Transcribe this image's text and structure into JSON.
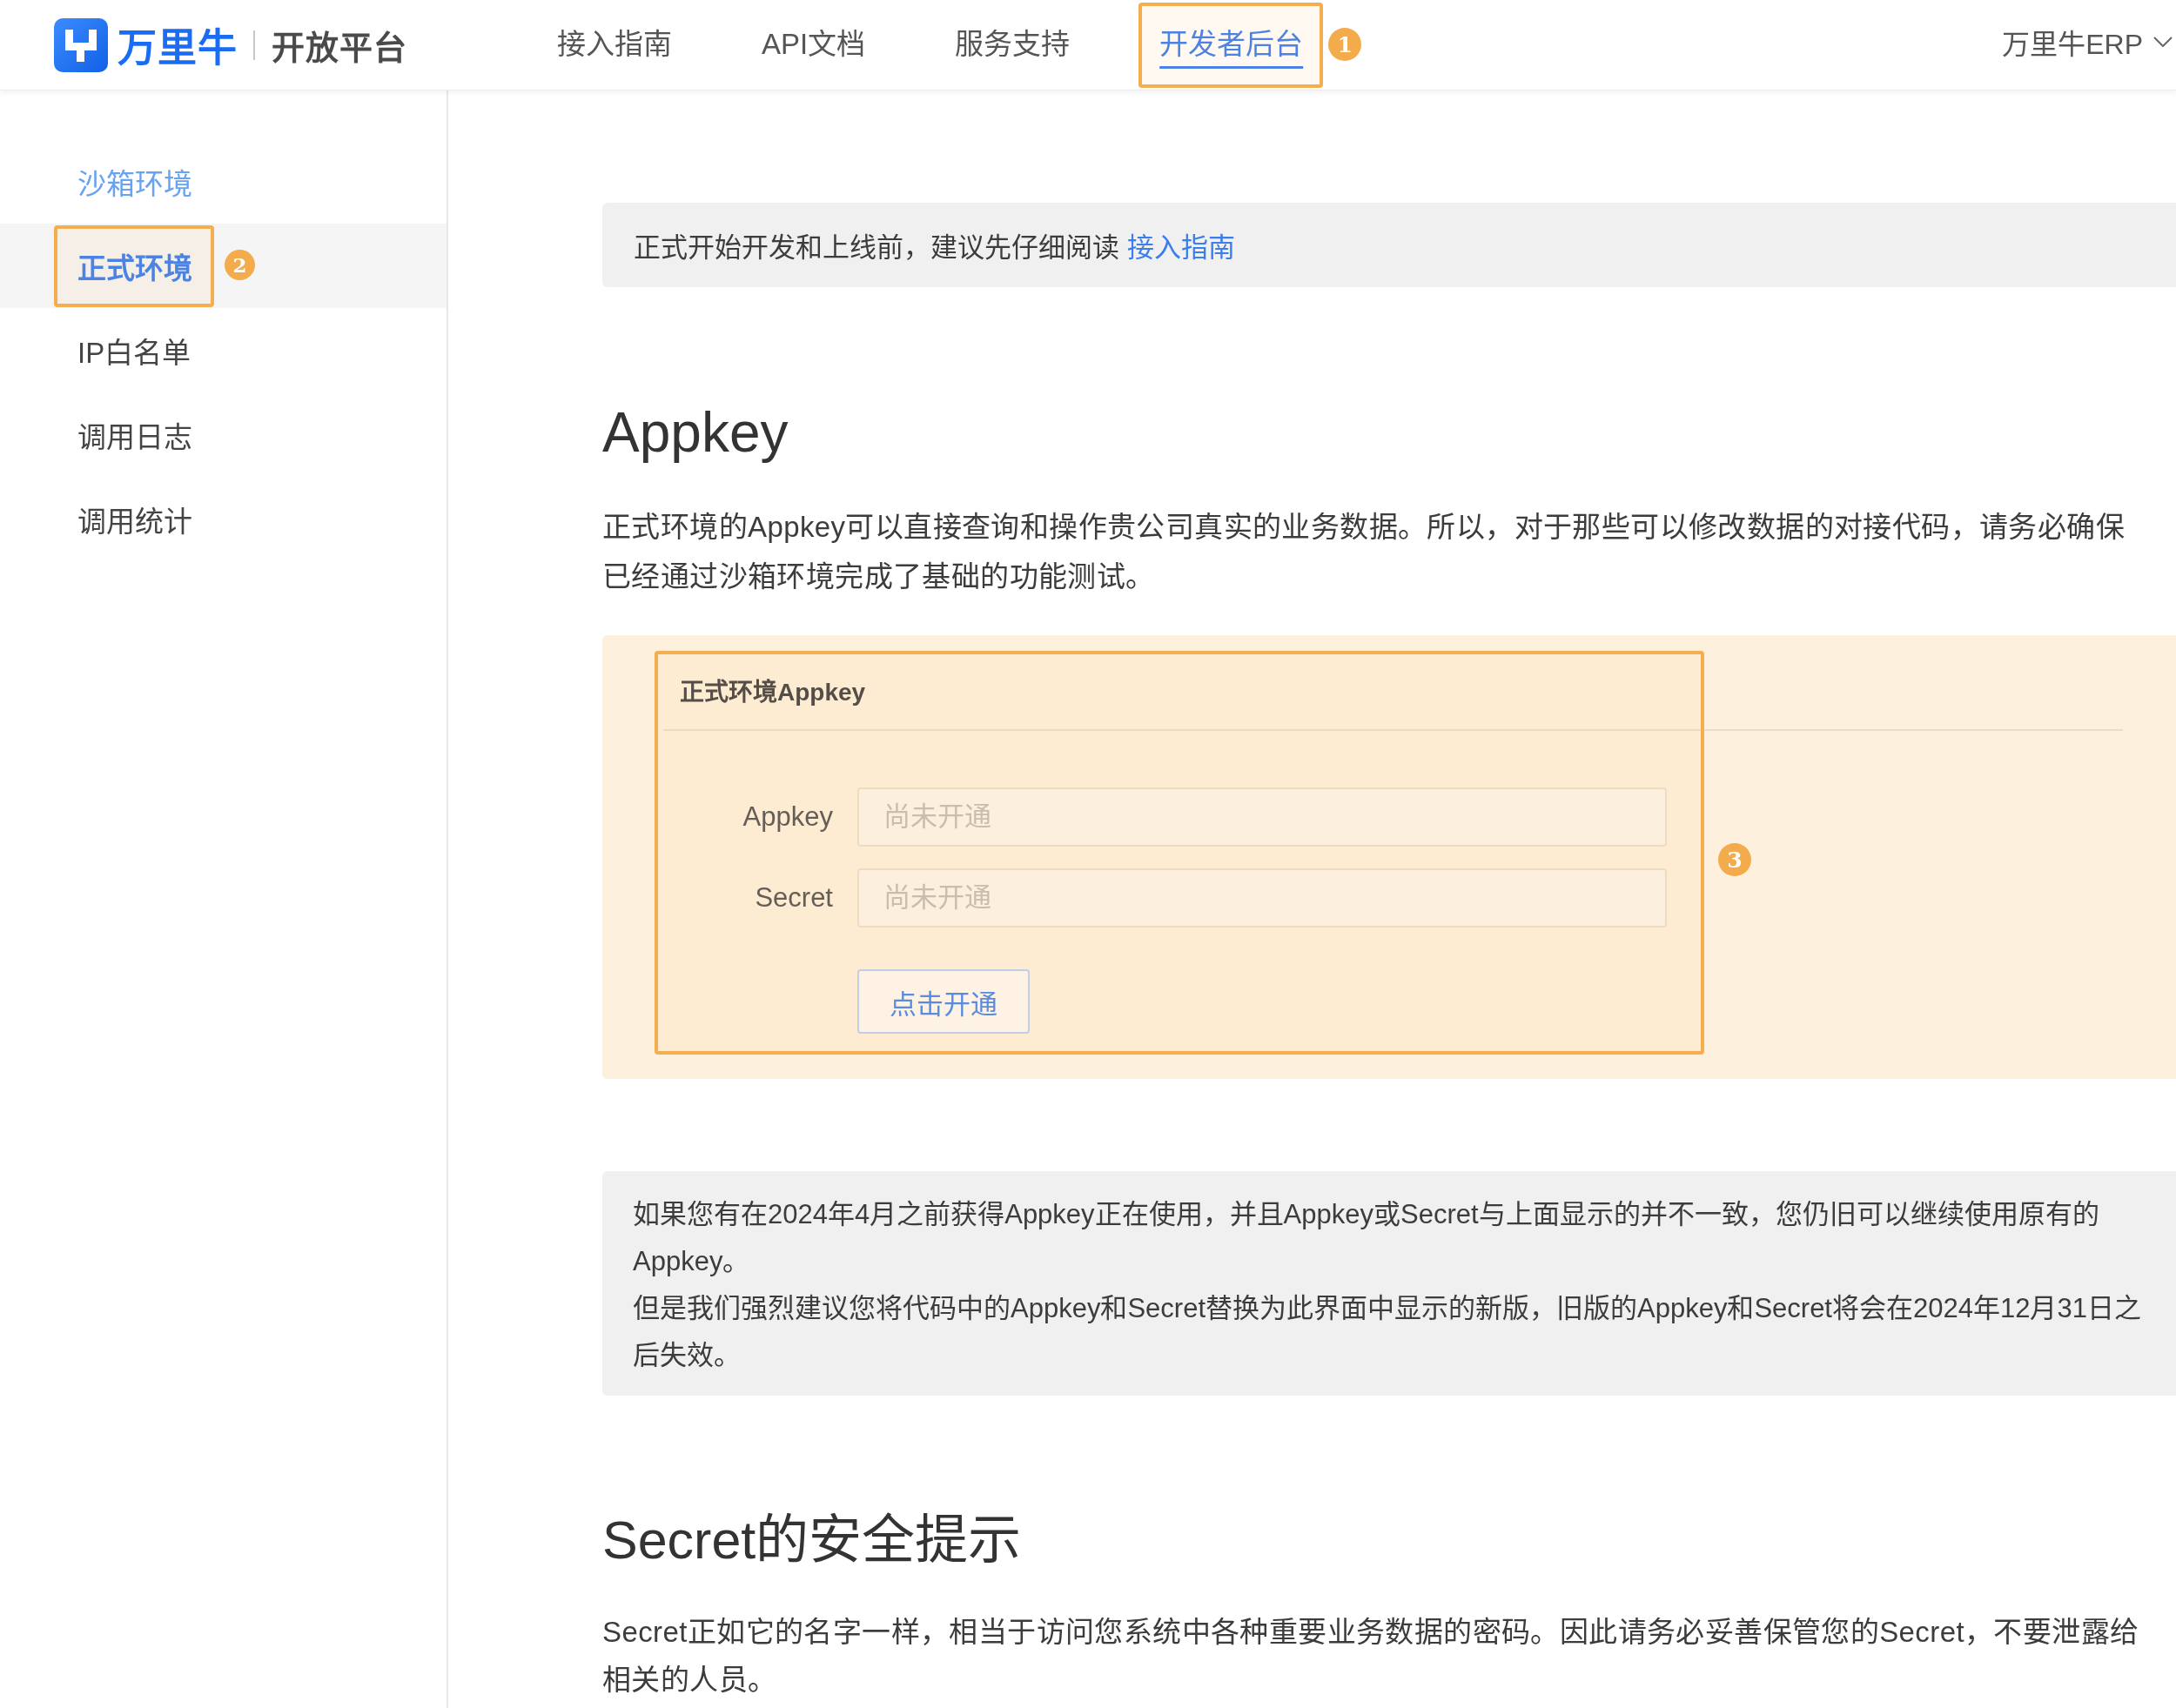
{
  "header": {
    "logo": {
      "wordmark": "万里牛",
      "product": "开放平台"
    },
    "nav": [
      {
        "label": "接入指南",
        "selected": false
      },
      {
        "label": "API文档",
        "selected": false
      },
      {
        "label": "服务支持",
        "selected": false
      },
      {
        "label": "开发者后台",
        "selected": true,
        "annotation": "1"
      }
    ],
    "account": {
      "label": "万里牛ERP"
    }
  },
  "sidebar": {
    "items": [
      {
        "label": "沙箱环境",
        "selected": false,
        "hovered": true
      },
      {
        "label": "正式环境",
        "selected": true,
        "hovered": false,
        "annotation": "2"
      },
      {
        "label": "IP白名单",
        "selected": false,
        "hovered": false
      },
      {
        "label": "调用日志",
        "selected": false,
        "hovered": false
      },
      {
        "label": "调用统计",
        "selected": false,
        "hovered": false
      }
    ]
  },
  "main": {
    "notice": {
      "text": "正式开始开发和上线前，建议先仔细阅读",
      "link": "接入指南"
    },
    "appkey_section": {
      "heading": "Appkey",
      "lines": [
        "正式环境的Appkey可以直接查询和操作贵公司真实的业务数据。所以，对于那些可以修改数据的对接代码，请务必确保",
        "已经通过沙箱环境完成了基础的功能测试。"
      ],
      "card": {
        "title": "正式环境Appkey",
        "fields": [
          {
            "label": "Appkey",
            "placeholder": "尚未开通"
          },
          {
            "label": "Secret",
            "placeholder": "尚未开通"
          }
        ],
        "button": "点击开通",
        "annotation": "3"
      }
    },
    "legacy_notice": {
      "paragraphs": [
        "如果您有在2024年4月之前获得Appkey正在使用，并且Appkey或Secret与上面显示的并不一致，您仍旧可以继续使用原有的Appkey。",
        "但是我们强烈建议您将代码中的Appkey和Secret替换为此界面中显示的新版，旧版的Appkey和Secret将会在2024年12月31日之后失效。"
      ]
    },
    "secret_section": {
      "heading": "Secret的安全提示",
      "lines": [
        "Secret正如它的名字一样，相当于访问您系统中各种重要业务数据的密码。因此请务必妥善保管您的Secret，不要泄露给",
        "相关的人员。"
      ]
    }
  }
}
